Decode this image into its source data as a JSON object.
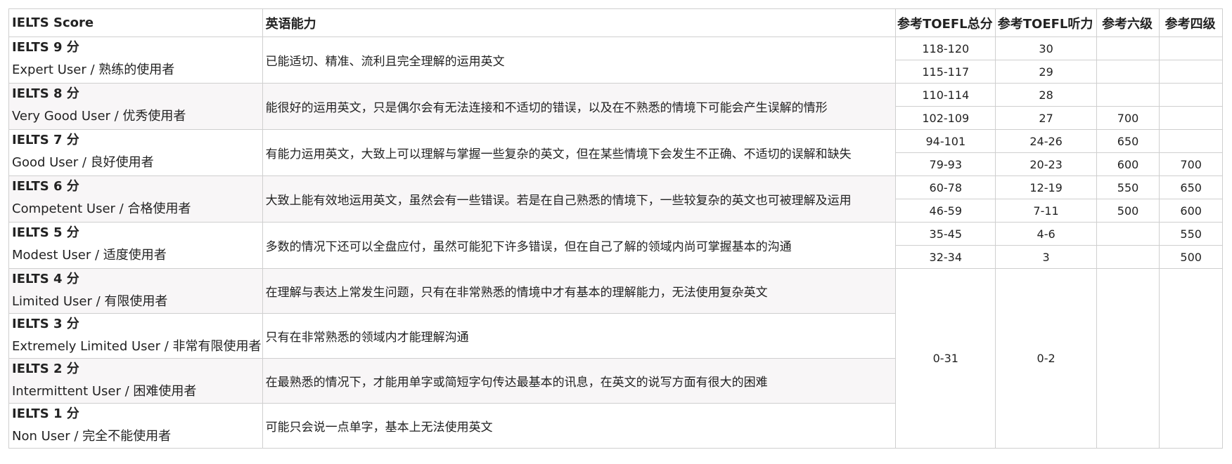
{
  "headers": {
    "score": "IELTS Score",
    "ability": "英语能力",
    "toefl_total": "参考TOEFL总分",
    "toefl_listening": "参考TOEFL听力",
    "cet6": "参考六级",
    "cet4": "参考四级"
  },
  "bands": [
    {
      "level": "IELTS 9 分",
      "user": "Expert User / 熟练的使用者",
      "desc": "已能适切、精准、流利且完全理解的运用英文",
      "rows": [
        {
          "total": "118-120",
          "listen": "30",
          "cet6": "",
          "cet4": ""
        },
        {
          "total": "115-117",
          "listen": "29",
          "cet6": "",
          "cet4": ""
        }
      ]
    },
    {
      "level": "IELTS 8 分",
      "user": "Very Good User / 优秀使用者",
      "desc": "能很好的运用英文，只是偶尔会有无法连接和不适切的错误，以及在不熟悉的情境下可能会产生误解的情形",
      "rows": [
        {
          "total": "110-114",
          "listen": "28",
          "cet6": "",
          "cet4": ""
        },
        {
          "total": "102-109",
          "listen": "27",
          "cet6": "700",
          "cet4": ""
        }
      ]
    },
    {
      "level": "IELTS 7 分",
      "user": "Good User / 良好使用者",
      "desc": "有能力运用英文，大致上可以理解与掌握一些复杂的英文，但在某些情境下会发生不正确、不适切的误解和缺失",
      "rows": [
        {
          "total": "94-101",
          "listen": "24-26",
          "cet6": "650",
          "cet4": ""
        },
        {
          "total": "79-93",
          "listen": "20-23",
          "cet6": "600",
          "cet4": "700"
        }
      ]
    },
    {
      "level": "IELTS 6 分",
      "user": "Competent User / 合格使用者",
      "desc": "大致上能有效地运用英文，虽然会有一些错误。若是在自己熟悉的情境下，一些较复杂的英文也可被理解及运用",
      "rows": [
        {
          "total": "60-78",
          "listen": "12-19",
          "cet6": "550",
          "cet4": "650"
        },
        {
          "total": "46-59",
          "listen": "7-11",
          "cet6": "500",
          "cet4": "600"
        }
      ]
    },
    {
      "level": "IELTS 5 分",
      "user": "Modest User / 适度使用者",
      "desc": "多数的情况下还可以全盘应付，虽然可能犯下许多错误，但在自己了解的领域内尚可掌握基本的沟通",
      "rows": [
        {
          "total": "35-45",
          "listen": "4-6",
          "cet6": "",
          "cet4": "550"
        },
        {
          "total": "32-34",
          "listen": "3",
          "cet6": "",
          "cet4": "500"
        }
      ]
    },
    {
      "level": "IELTS 4 分",
      "user": "Limited User / 有限使用者",
      "desc": "在理解与表达上常发生问题，只有在非常熟悉的情境中才有基本的理解能力，无法使用复杂英文"
    },
    {
      "level": "IELTS 3 分",
      "user": "Extremely Limited User / 非常有限使用者",
      "desc": "只有在非常熟悉的领域内才能理解沟通"
    },
    {
      "level": "IELTS 2 分",
      "user": "Intermittent User / 困难使用者",
      "desc": "在最熟悉的情况下，才能用单字或简短字句传达最基本的讯息，在英文的说写方面有很大的困难"
    },
    {
      "level": "IELTS 1 分",
      "user": "Non User / 完全不能使用者",
      "desc": "可能只会说一点单字，基本上无法使用英文"
    }
  ],
  "low_bands": {
    "total": "0-31",
    "listen": "0-2",
    "cet6": "",
    "cet4": ""
  }
}
